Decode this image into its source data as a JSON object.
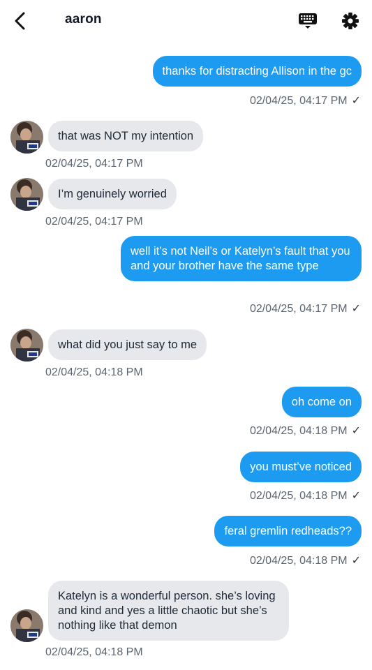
{
  "header": {
    "contact_name": "aaron",
    "back_icon": "chevron-left-icon",
    "keyboard_icon": "keyboard-icon",
    "settings_icon": "gear-icon"
  },
  "colors": {
    "outgoing_bubble": "#1d9bf0",
    "incoming_bubble": "#e6e8eb",
    "timestamp": "#5b6470"
  },
  "messages": [
    {
      "direction": "out",
      "text": "thanks for distracting Allison in the gc",
      "timestamp": "02/04/25, 04:17 PM",
      "read_mark": "✓"
    },
    {
      "direction": "in",
      "text": "that was NOT my intention",
      "timestamp": "02/04/25, 04:17 PM"
    },
    {
      "direction": "in",
      "text": "I’m genuinely worried",
      "timestamp": "02/04/25, 04:17 PM"
    },
    {
      "direction": "out",
      "text": "well it’s not Neil’s or Katelyn’s fault that you and your brother have the same type",
      "timestamp": "02/04/25, 04:17 PM",
      "read_mark": "✓"
    },
    {
      "direction": "in",
      "text": "what did you just say to me",
      "timestamp": "02/04/25, 04:18 PM"
    },
    {
      "direction": "out",
      "text": "oh come on",
      "timestamp": "02/04/25, 04:18 PM",
      "read_mark": "✓"
    },
    {
      "direction": "out",
      "text": "you must’ve noticed",
      "timestamp": "02/04/25, 04:18 PM",
      "read_mark": "✓"
    },
    {
      "direction": "out",
      "text": "feral gremlin redheads??",
      "timestamp": "02/04/25, 04:18 PM",
      "read_mark": "✓"
    },
    {
      "direction": "in",
      "text": "Katelyn is a wonderful person. she’s loving and kind and yes a little chaotic but she’s nothing like that demon",
      "timestamp": "02/04/25, 04:18 PM"
    }
  ]
}
